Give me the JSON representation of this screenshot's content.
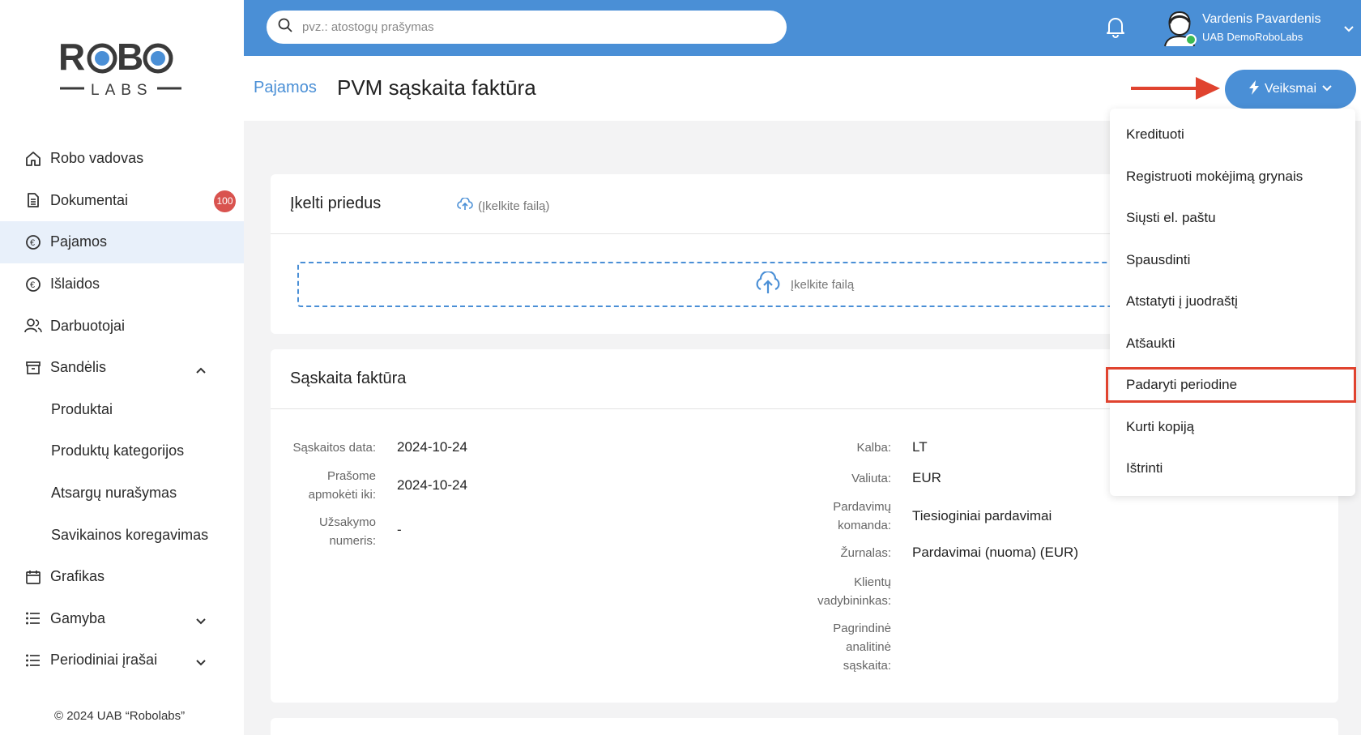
{
  "sidebar": {
    "logo_top": "ROBO",
    "logo_bottom": "LABS",
    "items": [
      {
        "label": "Robo vadovas"
      },
      {
        "label": "Dokumentai",
        "badge": "100"
      },
      {
        "label": "Pajamos"
      },
      {
        "label": "Išlaidos"
      },
      {
        "label": "Darbuotojai"
      },
      {
        "label": "Sandėlis"
      },
      {
        "label": "Produktai"
      },
      {
        "label": "Produktų kategorijos"
      },
      {
        "label": "Atsargų nurašymas"
      },
      {
        "label": "Savikainos koregavimas"
      },
      {
        "label": "Grafikas"
      },
      {
        "label": "Gamyba"
      },
      {
        "label": "Periodiniai įrašai"
      }
    ],
    "copyright": "© 2024 UAB “Robolabs”"
  },
  "topbar": {
    "search_placeholder": "pvz.: atostogų prašymas",
    "user_name": "Vardenis Pavardenis",
    "user_company": "UAB DemoRoboLabs"
  },
  "header": {
    "breadcrumb": "Pajamos",
    "title": "PVM sąskaita faktūra",
    "actions_label": "Veiksmai"
  },
  "attachments": {
    "title": "Įkelti priedus",
    "upload_link": "(Įkelkite failą)",
    "dropzone_label": "Įkelkite failą"
  },
  "invoice": {
    "title": "Sąskaita faktūra",
    "left_fields": [
      {
        "label": "Sąskaitos data:",
        "value": "2024-10-24"
      },
      {
        "label_1": "Prašome",
        "label_2": "apmokėti iki:",
        "value": "2024-10-24"
      },
      {
        "label_1": "Užsakymo",
        "label_2": "numeris:",
        "value": "-"
      }
    ],
    "right_fields": [
      {
        "label": "Kalba:",
        "value": "LT"
      },
      {
        "label": "Valiuta:",
        "value": "EUR"
      },
      {
        "label_1": "Pardavimų",
        "label_2": "komanda:",
        "value": "Tiesioginiai pardavimai"
      },
      {
        "label": "Žurnalas:",
        "value": "Pardavimai (nuoma) (EUR)"
      },
      {
        "label_1": "Klientų",
        "label_2": "vadybininkas:",
        "value": ""
      },
      {
        "label_1": "Pagrindinė",
        "label_2": "analitinė",
        "label_3": "sąskaita:",
        "value": ""
      }
    ]
  },
  "menu": {
    "items": [
      "Kredituoti",
      "Registruoti mokėjimą grynais",
      "Siųsti el. paštu",
      "Spausdinti",
      "Atstatyti į juodraštį",
      "Atšaukti",
      "Padaryti periodine",
      "Kurti kopiją",
      "Ištrinti"
    ],
    "highlighted_index": 6
  },
  "colors": {
    "primary": "#4a8fd6",
    "highlight": "#e0432f",
    "badge": "#d9534f",
    "active_nav_bg": "#e8f0fa"
  }
}
